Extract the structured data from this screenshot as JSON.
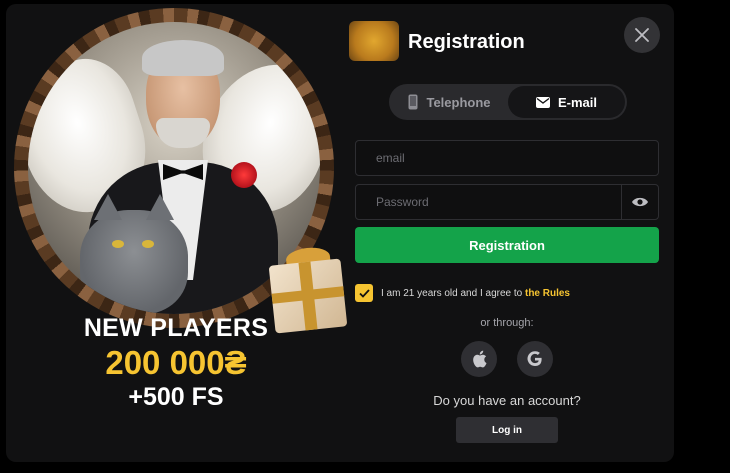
{
  "header": {
    "title": "Registration",
    "close_icon": "close-icon"
  },
  "tabs": [
    {
      "label": "Telephone",
      "icon": "phone-icon",
      "active": false
    },
    {
      "label": "E-mail",
      "icon": "envelope-icon",
      "active": true
    }
  ],
  "form": {
    "email_placeholder": "email",
    "password_placeholder": "Password",
    "submit_label": "Registration",
    "agree_text": "I am 21 years old and I agree to",
    "rules_link": "the Rules",
    "agree_checked": true,
    "or_through": "or through:",
    "socials": [
      {
        "icon": "apple-icon"
      },
      {
        "icon": "google-icon"
      }
    ],
    "have_account": "Do you have an account?",
    "login_label": "Log in"
  },
  "promo": {
    "title": "NEW PLAYERS",
    "amount": "200 000₴",
    "free_spins": "+500 FS"
  },
  "colors": {
    "accent": "#14a34a",
    "gold": "#f6c431",
    "bg": "#111112"
  }
}
